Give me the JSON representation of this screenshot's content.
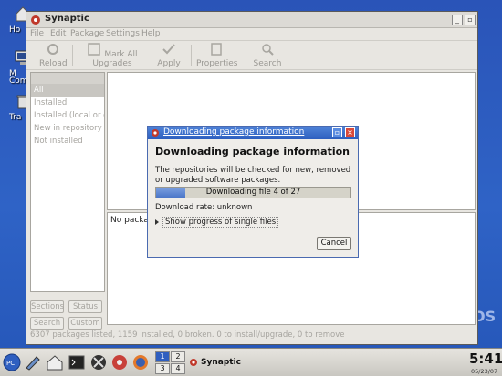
{
  "desktop": {
    "icons": [
      {
        "label": "Ho"
      },
      {
        "label": "M",
        "label2": "Com"
      },
      {
        "label": "Tra"
      }
    ],
    "watermark": "OS"
  },
  "window": {
    "title": "Synaptic",
    "menu": [
      "File",
      "Edit",
      "Package",
      "Settings",
      "Help"
    ],
    "toolbar": [
      {
        "label": "Reload",
        "icon": "reload-icon"
      },
      {
        "label": "Mark All Upgrades",
        "icon": "mark-upgrades-icon"
      },
      {
        "label": "Apply",
        "icon": "apply-icon"
      },
      {
        "label": "Properties",
        "icon": "properties-icon"
      },
      {
        "label": "Search",
        "icon": "search-icon"
      }
    ],
    "filters": {
      "header": "All",
      "items": [
        "Installed",
        "Installed (local or ot",
        "New in repository",
        "Not installed"
      ]
    },
    "left_buttons": [
      "Sections",
      "Status",
      "Search",
      "Custom"
    ],
    "description": "No package",
    "statusbar": "6307 packages listed, 1159 installed, 0 broken. 0 to install/upgrade, 0 to remove"
  },
  "dialog": {
    "title": "Downloading package information",
    "heading": "Downloading package information",
    "message": "The repositories will be checked for new, removed or upgraded software packages.",
    "progress_text": "Downloading file 4 of 27",
    "progress_fraction": 0.148,
    "rate": "Download rate: unknown",
    "expander": "Show progress of single files",
    "cancel": "Cancel"
  },
  "taskbar": {
    "pager": [
      "1",
      "2",
      "3",
      "4"
    ],
    "task": "Synaptic",
    "clock": "5:41",
    "date": "05/23/07"
  },
  "colors": {
    "desktop": "#2f63c6",
    "dialog_title": "#2d5fbf",
    "progress_fill": "#4b76c8"
  }
}
